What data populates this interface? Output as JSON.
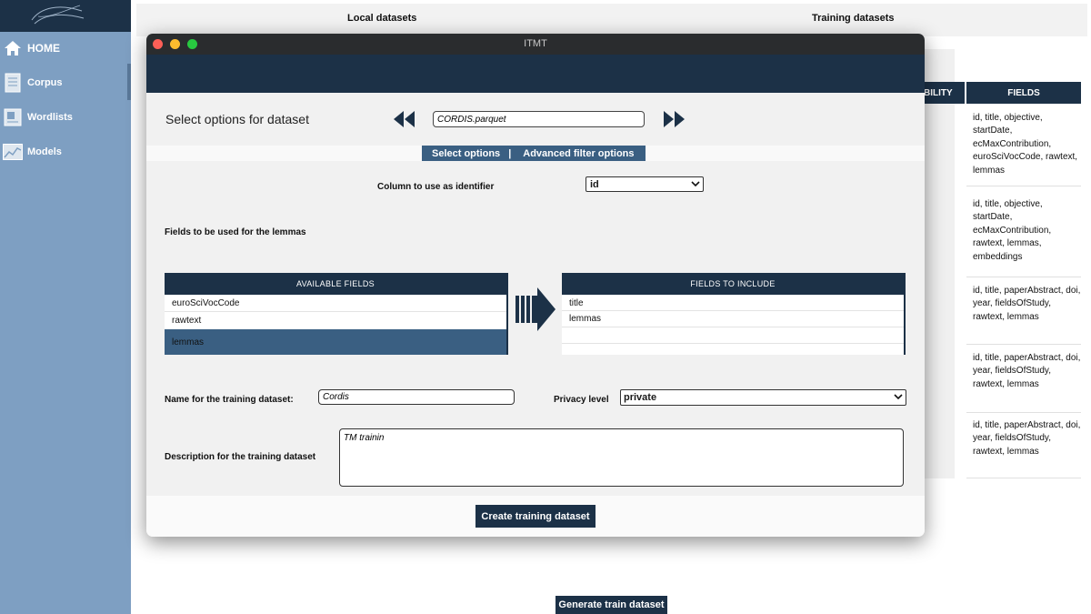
{
  "app": {
    "window_title": "ITMT"
  },
  "sidebar": {
    "items": [
      {
        "label": "HOME",
        "icon": "home-icon"
      },
      {
        "label": "Corpus",
        "icon": "document-icon"
      },
      {
        "label": "Wordlists",
        "icon": "list-icon"
      },
      {
        "label": "Models",
        "icon": "chart-icon"
      }
    ]
  },
  "background": {
    "tabs": [
      "Local datasets",
      "Training datasets"
    ],
    "table": {
      "visibility_header": "BILITY",
      "fields_header": "FIELDS",
      "rows": [
        "id, title, objective, startDate, ecMaxContribution, euroSciVocCode, rawtext, lemmas",
        "id, title, objective, startDate, ecMaxContribution, rawtext, lemmas, embeddings",
        "id, title, paperAbstract, doi, year, fieldsOfStudy, rawtext, lemmas",
        "id, title, paperAbstract, doi, year, fieldsOfStudy, rawtext, lemmas",
        "id, title, paperAbstract, doi, year, fieldsOfStudy, rawtext, lemmas"
      ]
    },
    "generate_button": "Generate train dataset"
  },
  "modal": {
    "title": "Select options for dataset",
    "dataset_value": "CORDIS.parquet",
    "tabs": {
      "select": "Select options",
      "separator": "|",
      "advanced": "Advanced filter options"
    },
    "identifier": {
      "label": "Column to use as identifier",
      "value": "id"
    },
    "lemmas_label": "Fields to be used for the lemmas",
    "available": {
      "header": "AVAILABLE FIELDS",
      "items": [
        "euroSciVocCode",
        "rawtext",
        "lemmas"
      ]
    },
    "include": {
      "header": "FIELDS TO INCLUDE",
      "items": [
        "title",
        "lemmas"
      ]
    },
    "name": {
      "label": "Name for the training dataset:",
      "value": "Cordis"
    },
    "privacy": {
      "label": "Privacy level",
      "value": "private"
    },
    "description": {
      "label": "Description for the training dataset",
      "value": "TM trainin"
    },
    "create_button": "Create training dataset"
  },
  "colors": {
    "navy": "#1c3147",
    "sidebar": "#7e9fc2",
    "accent": "#3a5f82"
  }
}
